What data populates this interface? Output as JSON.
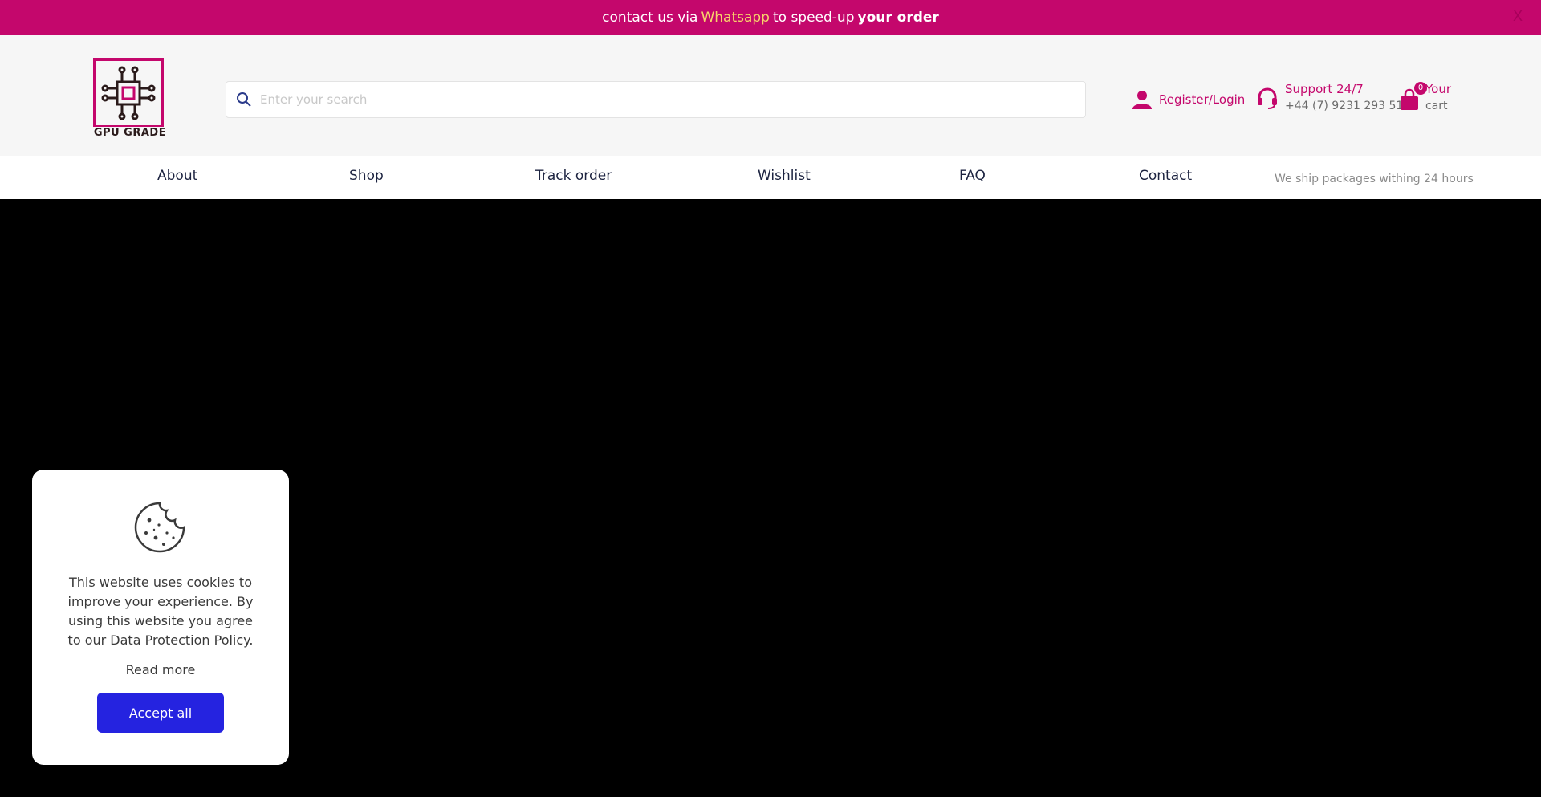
{
  "topbar": {
    "prefix": "contact us via",
    "whatsapp": "Whatsapp",
    "middle": "to speed-up",
    "bold": "your order",
    "close_symbol": "X",
    "background": "#c4076c",
    "whatsapp_color": "#f7d36a"
  },
  "brand": {
    "name": "GPU GRADE",
    "accent": "#c4076c"
  },
  "search": {
    "placeholder": "Enter your search",
    "value": "",
    "icon": "search-icon"
  },
  "account": {
    "label": "Register/Login",
    "icon": "user-icon"
  },
  "support": {
    "line1": "Support 24/7",
    "line2": "+44 (7) 9231 293 51",
    "icon": "headset-icon"
  },
  "cart": {
    "count": "0",
    "line1": "Your",
    "line2": "cart",
    "icon": "shopping-bag-icon"
  },
  "nav": {
    "items": [
      {
        "label": "About"
      },
      {
        "label": "Shop"
      },
      {
        "label": "Track order"
      },
      {
        "label": "Wishlist"
      },
      {
        "label": "FAQ"
      },
      {
        "label": "Contact"
      }
    ],
    "shipping_note": "We ship packages withing 24 hours"
  },
  "cookie": {
    "icon": "cookie-icon",
    "message": "This website uses cookies to improve your experience. By using this website you agree to our Data Protection Policy.",
    "read_more": "Read more",
    "accept_label": "Accept all",
    "accept_color": "#2523e0"
  }
}
